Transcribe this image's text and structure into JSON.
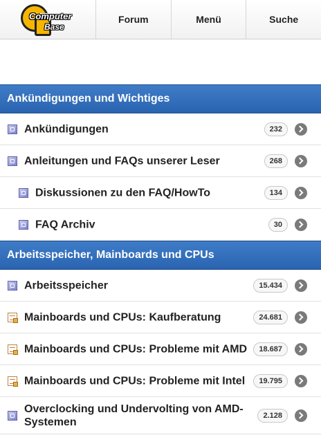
{
  "header": {
    "logo_text_top": "Computer",
    "logo_text_bottom": "Base",
    "nav": [
      "Forum",
      "Menü",
      "Suche"
    ]
  },
  "sections": [
    {
      "title": "Ankündigungen und Wichtiges",
      "forums": [
        {
          "title": "Ankündigungen",
          "count": "232",
          "icon": "folder-icon"
        },
        {
          "title": "Anleitungen und FAQs unserer Leser",
          "count": "268",
          "icon": "folder-icon"
        },
        {
          "title": "Diskussionen zu den FAQ/HowTo",
          "count": "134",
          "icon": "folder-icon"
        },
        {
          "title": "FAQ Archiv",
          "count": "30",
          "icon": "folder-icon"
        }
      ]
    },
    {
      "title": "Arbeitsspeicher, Mainboards und CPUs",
      "forums": [
        {
          "title": "Arbeitsspeicher",
          "count": "15.434",
          "icon": "folder-icon"
        },
        {
          "title": "Mainboards und CPUs: Kaufberatung",
          "count": "24.681",
          "icon": "document-icon"
        },
        {
          "title": "Mainboards und CPUs: Probleme mit AMD",
          "count": "18.687",
          "icon": "document-icon"
        },
        {
          "title": "Mainboards und CPUs: Probleme mit Intel",
          "count": "19.795",
          "icon": "document-icon"
        },
        {
          "title": "Overclocking und Undervolting von AMD-Systemen",
          "count": "2.128",
          "icon": "folder-icon"
        }
      ]
    }
  ],
  "colors": {
    "section_header": "#2f6cb8",
    "logo_yellow": "#f6b500",
    "arrow_grey": "#7a7a7a"
  }
}
